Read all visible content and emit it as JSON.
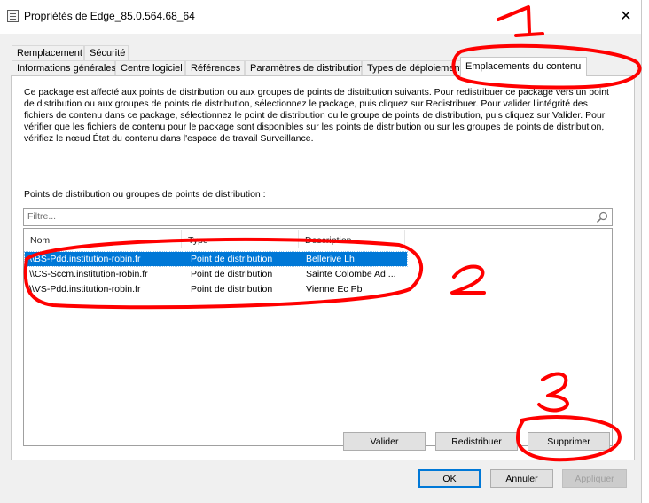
{
  "window": {
    "title": "Propriétés de Edge_85.0.564.68_64",
    "close_glyph": "✕"
  },
  "tabs_row1": [
    {
      "label": "Remplacement"
    },
    {
      "label": "Sécurité"
    }
  ],
  "tabs_row2": [
    {
      "label": "Informations générales"
    },
    {
      "label": "Centre logiciel"
    },
    {
      "label": "Références"
    },
    {
      "label": "Paramètres de distribution"
    },
    {
      "label": "Types de déploiement"
    },
    {
      "label": "Emplacements du contenu",
      "active": true
    }
  ],
  "content": {
    "description": "Ce package est affecté aux points de distribution ou aux groupes de points de distribution suivants. Pour redistribuer ce package vers un point de distribution ou aux groupes de points de distribution, sélectionnez le package, puis cliquez sur Redistribuer. Pour valider l'intégrité des fichiers de contenu dans ce package, sélectionnez le point de distribution ou le groupe de points de distribution, puis cliquez sur Valider. Pour vérifier que les fichiers de contenu pour le package sont disponibles sur les points de distribution ou sur les groupes de points de distribution, vérifiez le nœud État du contenu dans l'espace de travail Surveillance.",
    "list_label": "Points de distribution ou groupes de points de distribution :",
    "filter_placeholder": "Filtre..."
  },
  "list": {
    "columns": [
      "Nom",
      "Type",
      "Description"
    ],
    "rows": [
      {
        "name": "\\\\BS-Pdd.institution-robin.fr",
        "type": "Point de distribution",
        "description": "Bellerive Lh",
        "selected": true
      },
      {
        "name": "\\\\CS-Sccm.institution-robin.fr",
        "type": "Point de distribution",
        "description": "Sainte Colombe Ad ...",
        "selected": false
      },
      {
        "name": "\\\\VS-Pdd.institution-robin.fr",
        "type": "Point de distribution",
        "description": "Vienne Ec Pb",
        "selected": false
      }
    ]
  },
  "panel_buttons": {
    "validate": "Valider",
    "redistribute": "Redistribuer",
    "delete": "Supprimer"
  },
  "dialog_buttons": {
    "ok": "OK",
    "cancel": "Annuler",
    "apply": "Appliquer"
  },
  "annotations": {
    "color": "#ff0000",
    "labels": [
      "1",
      "2",
      "3"
    ]
  }
}
